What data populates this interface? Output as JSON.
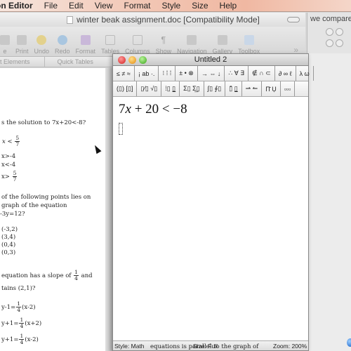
{
  "menubar": {
    "app_name": "on Editor",
    "items": [
      "File",
      "Edit",
      "View",
      "Format",
      "Style",
      "Size",
      "Help"
    ]
  },
  "word_window": {
    "title": "winter beak assignment.doc [Compatibility Mode]",
    "toolbar": [
      "e",
      "Print",
      "Undo",
      "Redo",
      "Format",
      "Tables",
      "Columns",
      "Show",
      "Navigation",
      "Gallery",
      "Toolbox"
    ],
    "more": "»",
    "ribbon_tabs": [
      "t Elements",
      "Quick Tables"
    ]
  },
  "background_window": {
    "title": "we compare"
  },
  "document": {
    "q1": {
      "prompt": "s the solution to 7x+20<-8?",
      "a_prefix": "x <",
      "a_num": "5",
      "a_den": "7",
      "b": "x>-4",
      "c": "x<-4",
      "d_prefix": "x>",
      "d_num": "5",
      "d_den": "7"
    },
    "q2": {
      "line1": "of the following points lies on",
      "line2": "graph of the equation",
      "line3": "-3y=12?",
      "options": [
        "(-3,2)",
        "(3,4)",
        "(0,4)",
        "(0,3)"
      ]
    },
    "q3": {
      "line1": "equation has a slope of",
      "slope_num": "1",
      "slope_den": "4",
      "line1_suffix": "and",
      "line2": "tains (2,1)?",
      "options": [
        {
          "prefix": "y-1=",
          "num": "1",
          "den": "4",
          "suffix": "(x-2)"
        },
        {
          "prefix": "y+1=",
          "num": "1",
          "den": "4",
          "suffix": "(x+2)"
        },
        {
          "prefix": "y+1=",
          "num": "1",
          "den": "4",
          "suffix": "(x-2)"
        }
      ]
    },
    "bottom_text": "equations is parallel to the graph of"
  },
  "equation_editor": {
    "title": "Untitled 2",
    "palette_row1": [
      "≤ ≠ ≈",
      "¡ ab ·.",
      "⁝ ⁞ ⁞",
      "± • ⊗",
      "→ ⇔ ↓",
      "∴ ∀ ∃",
      "∉ ∩ ⊂",
      "∂ ∞ ℓ",
      "λ ω"
    ],
    "palette_row2": [
      "(▯) [▯]",
      "▯⁄▯ √▯",
      "⁞▯ ▯̲",
      "Σ▯ Σ̲▯",
      "∫▯ ∮▯",
      "▯̄ ▯̲",
      "⇀ ↼",
      "Π̄ Ụ",
      "▫▫▫"
    ],
    "equation": {
      "coef": "7",
      "var": "x",
      "rest": " + 20 < −8"
    },
    "status": {
      "style": "Style: Math",
      "size": "Size: Full",
      "zoom": "Zoom: 200%"
    }
  }
}
